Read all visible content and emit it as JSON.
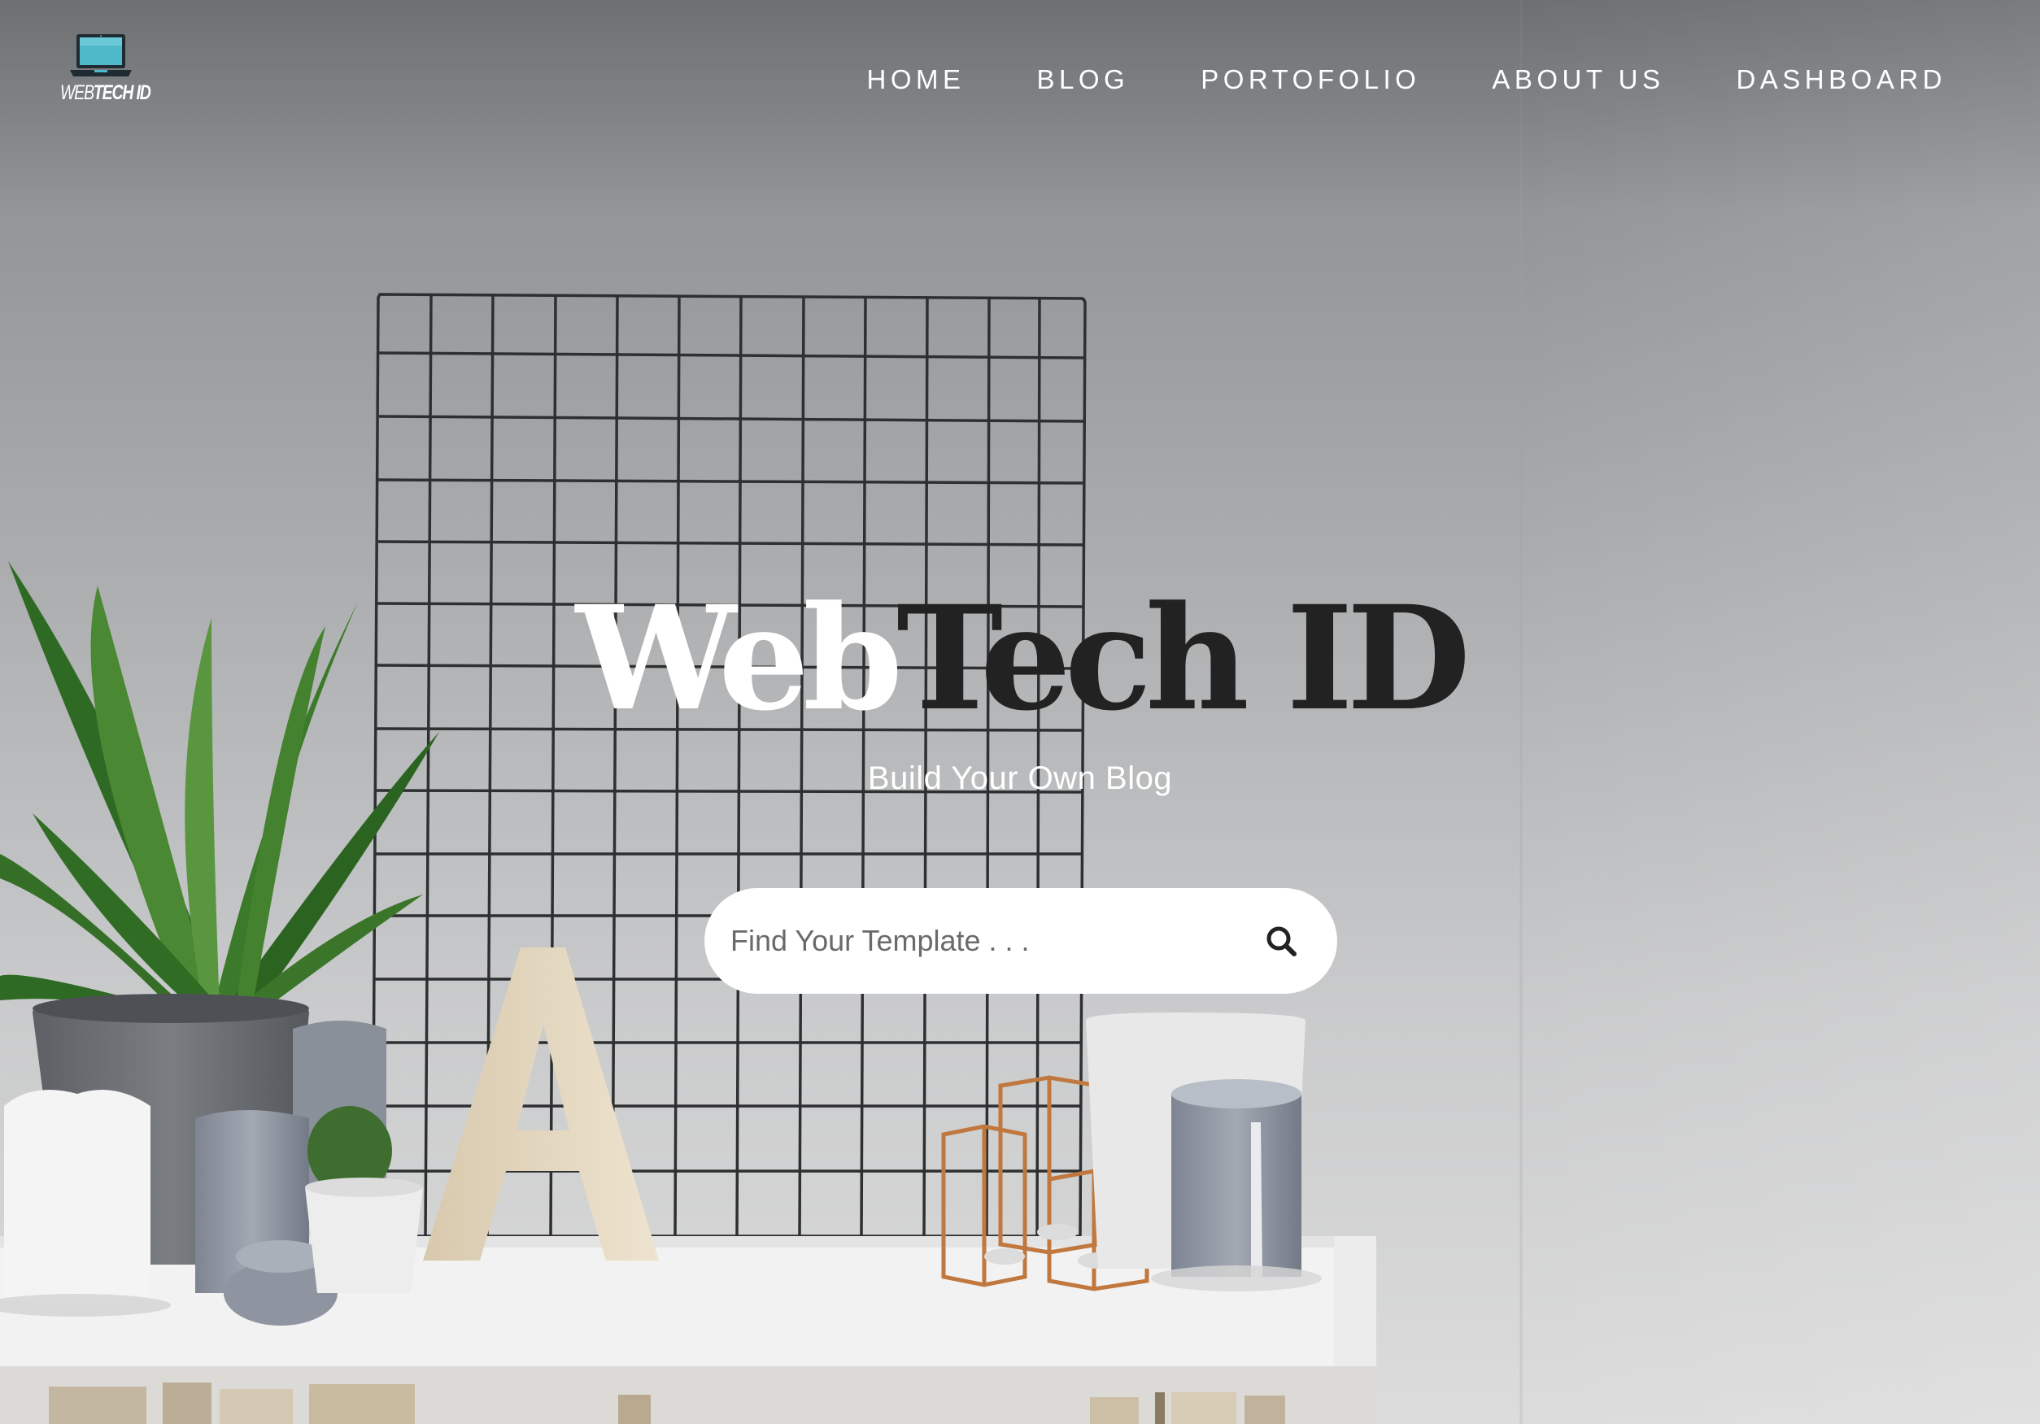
{
  "brand": {
    "logo_text_light": "WEB",
    "logo_text_bold": "TECH ID",
    "logo_icon": "laptop-icon"
  },
  "nav": {
    "items": [
      {
        "label": "HOME"
      },
      {
        "label": "BLOG"
      },
      {
        "label": "PORTOFOLIO"
      },
      {
        "label": "ABOUT US"
      },
      {
        "label": "DASHBOARD"
      }
    ]
  },
  "hero": {
    "title_part_1": "Web",
    "title_part_2": "Tech ID",
    "subtitle": "Build Your Own Blog"
  },
  "search": {
    "placeholder": "Find Your Template . . .",
    "value": "",
    "icon": "search-icon"
  },
  "colors": {
    "title_light": "#ffffff",
    "title_dark": "#222222",
    "search_bg": "#ffffff",
    "nav_text": "#ffffff"
  }
}
